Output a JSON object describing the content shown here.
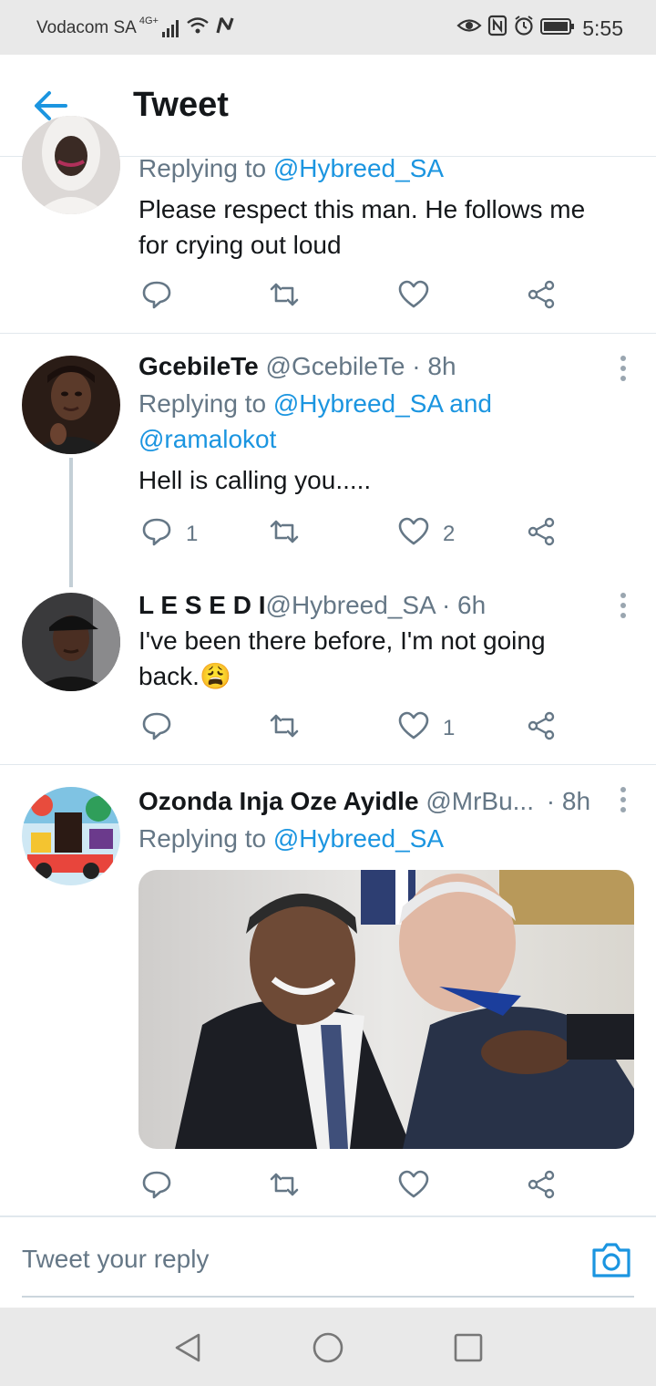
{
  "status_bar": {
    "carrier": "Vodacom SA",
    "network": "4G+",
    "time": "5:55"
  },
  "header": {
    "title": "Tweet"
  },
  "tweets": [
    {
      "reply_prefix": "Replying to",
      "reply_to": "@Hybreed_SA",
      "text_line1": "Please respect this man. He follows me",
      "text_line2": "for crying out loud",
      "replies": "",
      "likes": ""
    },
    {
      "name": "GcebileTe",
      "handle": "@GcebileTe",
      "time": "· 8h",
      "reply_prefix": "Replying to",
      "reply_to": "@Hybreed_SA and",
      "reply_to_2": "@ramalokot",
      "text_line1": "Hell is calling you.....",
      "replies": "1",
      "likes": "2"
    },
    {
      "name": "L E S E D I",
      "handle": "@Hybreed_SA",
      "time": "· 6h",
      "text_line1": "I've been there before, I'm not going",
      "text_line2": "back.",
      "emoji": "😩",
      "replies": "",
      "likes": "1"
    },
    {
      "name": "Ozonda Inja Oze Ayidle",
      "handle": "@MrBu...",
      "time": "· 8h",
      "reply_prefix": "Replying to",
      "reply_to": "@Hybreed_SA",
      "replies": "",
      "likes": ""
    }
  ],
  "reply_bar": {
    "placeholder": "Tweet your reply"
  },
  "colors": {
    "accent": "#1b95e0",
    "secondary_text": "#657786",
    "divider": "#e1e8ed"
  },
  "icons": [
    "back-arrow-icon",
    "reply-icon",
    "retweet-icon",
    "like-icon",
    "share-icon",
    "more-icon",
    "camera-icon",
    "nav-back-icon",
    "nav-home-icon",
    "nav-recents-icon"
  ]
}
